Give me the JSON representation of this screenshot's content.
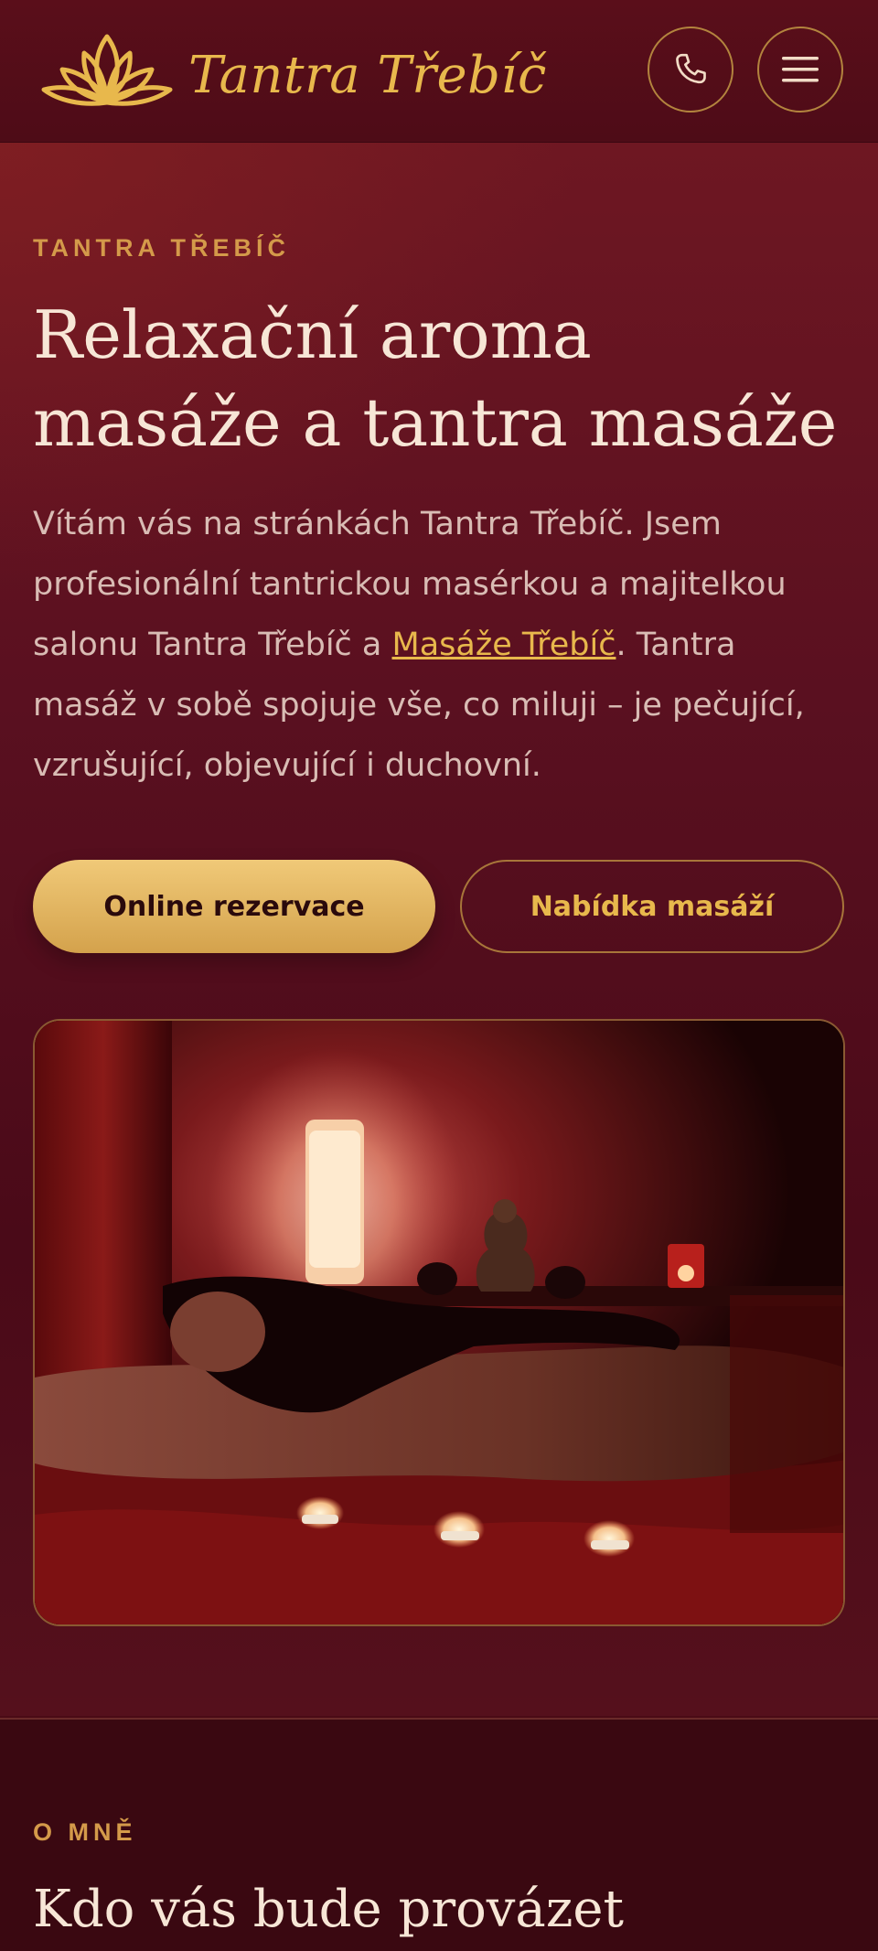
{
  "header": {
    "brand": "Tantra Třebíč",
    "phone_icon": "phone-icon",
    "menu_icon": "hamburger-menu-icon"
  },
  "hero": {
    "kicker": "TANTRA TŘEBÍČ",
    "title_line1": "Relaxační aroma",
    "title_line2": "masáže a tantra masáže",
    "text_before_link": "Vítám vás na stránkách Tantra Třebíč. Jsem profesionální tantrickou masérkou a majitelkou salonu Tantra Třebíč a ",
    "link_text": "Masáže Třebíč",
    "text_after_link": ". Tantra masáž v sobě spojuje vše, co miluji – je pečující, vzrušující, objevující i duchovní.",
    "primary_button": "Online rezervace",
    "secondary_button": "Nabídka masáží"
  },
  "about": {
    "kicker": "O MNĚ",
    "title": "Kdo vás bude provázet"
  },
  "colors": {
    "gold": "#e8b84c",
    "burgundy": "#5a0e1a",
    "cream": "#f7e6d6"
  }
}
